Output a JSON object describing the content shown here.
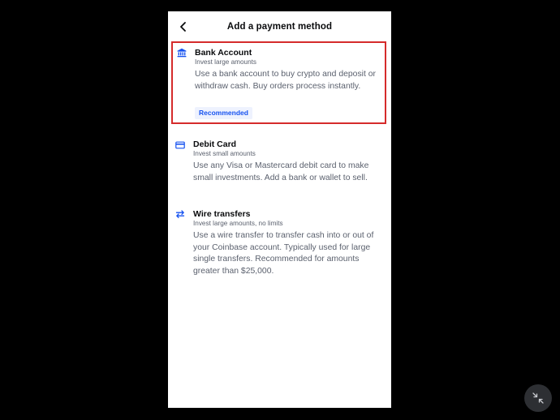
{
  "header": {
    "title": "Add a payment method",
    "back_icon": "chevron-left-icon"
  },
  "options": [
    {
      "icon": "bank-icon",
      "title": "Bank Account",
      "subtitle": "Invest large amounts",
      "description": "Use a bank account to buy crypto and deposit or withdraw cash. Buy orders process instantly.",
      "badge": "Recommended",
      "highlighted": true
    },
    {
      "icon": "credit-card-icon",
      "title": "Debit Card",
      "subtitle": "Invest small amounts",
      "description": "Use any Visa or Mastercard debit card to make small investments. Add a bank or wallet to sell."
    },
    {
      "icon": "transfer-arrows-icon",
      "title": "Wire transfers",
      "subtitle": "Invest large amounts, no limits",
      "description": "Use a wire transfer to transfer cash into or out of your Coinbase account. Typically used for large single transfers. Recommended for amounts greater than $25,000."
    }
  ],
  "overlay": {
    "collapse_icon": "collapse-arrows-icon"
  },
  "colors": {
    "accent": "#1652f0",
    "highlight_border": "#d52b2b",
    "badge_bg": "#eef2fe",
    "text_primary": "#0a0b0d",
    "text_secondary": "#5b616e",
    "screen_bg": "#000000"
  }
}
